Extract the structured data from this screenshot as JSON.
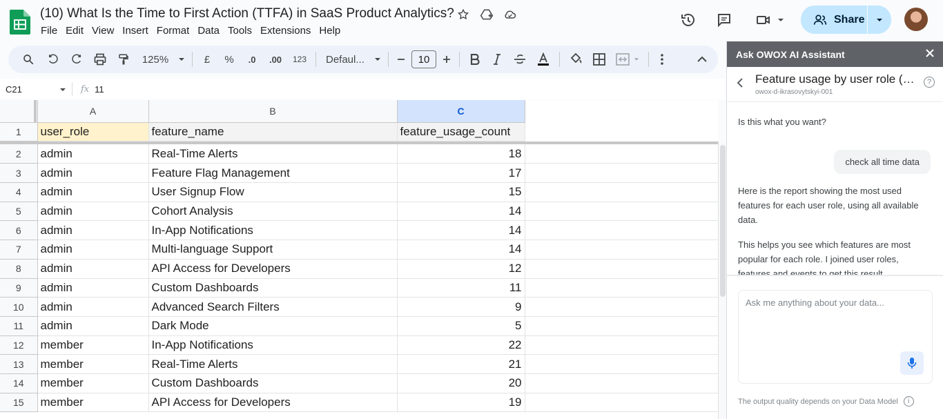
{
  "header": {
    "title": "(10) What Is the Time to First Action (TTFA) in SaaS Product Analytics?",
    "menu": [
      "File",
      "Edit",
      "View",
      "Insert",
      "Format",
      "Data",
      "Tools",
      "Extensions",
      "Help"
    ],
    "share_label": "Share"
  },
  "toolbar": {
    "zoom": "125%",
    "currency": "£",
    "percent": "%",
    "dec_decrease": ".0",
    "dec_increase": ".00",
    "number_format": "123",
    "font": "Defaul...",
    "font_size": "10"
  },
  "formula_bar": {
    "cell_ref": "C21",
    "fx": "fx",
    "value": "11"
  },
  "grid": {
    "columns": [
      "A",
      "B",
      "C"
    ],
    "selected_column": "C",
    "headers": [
      "user_role",
      "feature_name",
      "feature_usage_count"
    ],
    "rows": [
      {
        "n": "2",
        "role": "admin",
        "feature": "Real-Time Alerts",
        "count": "18"
      },
      {
        "n": "3",
        "role": "admin",
        "feature": "Feature Flag Management",
        "count": "17"
      },
      {
        "n": "4",
        "role": "admin",
        "feature": "User Signup Flow",
        "count": "15"
      },
      {
        "n": "5",
        "role": "admin",
        "feature": "Cohort Analysis",
        "count": "14"
      },
      {
        "n": "6",
        "role": "admin",
        "feature": "In-App Notifications",
        "count": "14"
      },
      {
        "n": "7",
        "role": "admin",
        "feature": "Multi-language Support",
        "count": "14"
      },
      {
        "n": "8",
        "role": "admin",
        "feature": "API Access for Developers",
        "count": "12"
      },
      {
        "n": "9",
        "role": "admin",
        "feature": "Custom Dashboards",
        "count": "11"
      },
      {
        "n": "10",
        "role": "admin",
        "feature": "Advanced Search Filters",
        "count": "9"
      },
      {
        "n": "11",
        "role": "admin",
        "feature": "Dark Mode",
        "count": "5"
      },
      {
        "n": "12",
        "role": "member",
        "feature": "In-App Notifications",
        "count": "22"
      },
      {
        "n": "13",
        "role": "member",
        "feature": "Real-Time Alerts",
        "count": "21"
      },
      {
        "n": "14",
        "role": "member",
        "feature": "Custom Dashboards",
        "count": "20"
      },
      {
        "n": "15",
        "role": "member",
        "feature": "API Access for Developers",
        "count": "19"
      }
    ]
  },
  "panel": {
    "title": "Ask OWOX AI Assistant",
    "subtitle": "Feature usage by user role (a...",
    "user": "owox-d-ikrasovytskyi-001",
    "msg_question": "Is this what you want?",
    "msg_user": "check all time data",
    "msg_report": "Here is the report showing the most used features for each user role, using all available data.",
    "msg_help": "This helps you see which features are most popular for each role. I joined user roles, features and events to get this result.",
    "input_placeholder": "Ask me anything about your data...",
    "footnote": "The output quality depends on your Data Model"
  }
}
